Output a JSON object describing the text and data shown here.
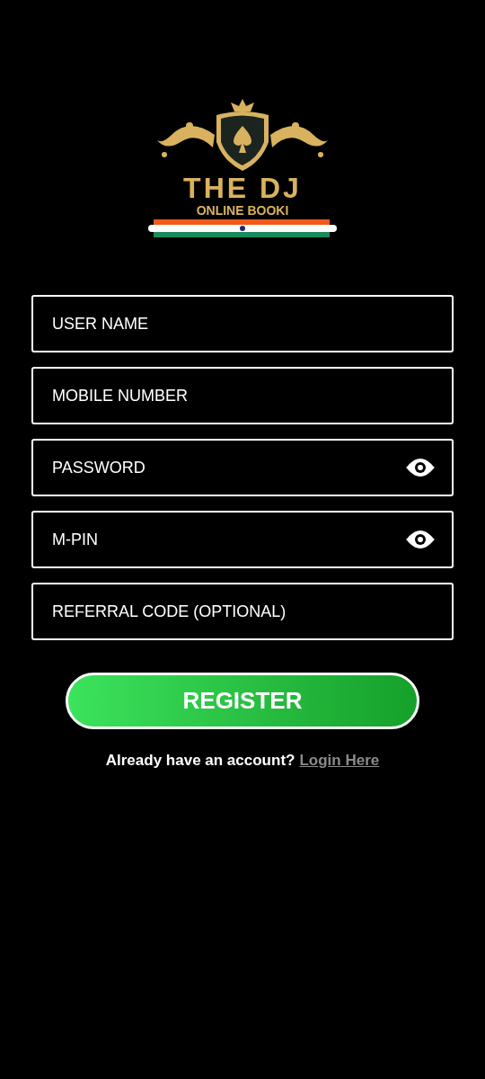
{
  "logo": {
    "title": "THE DJ",
    "subtitle": "ONLINE BOOKI"
  },
  "fields": [
    {
      "placeholder": "USER NAME",
      "kind": "text"
    },
    {
      "placeholder": "MOBILE NUMBER",
      "kind": "text"
    },
    {
      "placeholder": "PASSWORD",
      "kind": "secret"
    },
    {
      "placeholder": "M-PIN",
      "kind": "secret"
    },
    {
      "placeholder": "REFERRAL CODE (OPTIONAL)",
      "kind": "text"
    }
  ],
  "register_button": "REGISTER",
  "footer": {
    "prompt": "Already have an account?",
    "link": "Login Here"
  }
}
